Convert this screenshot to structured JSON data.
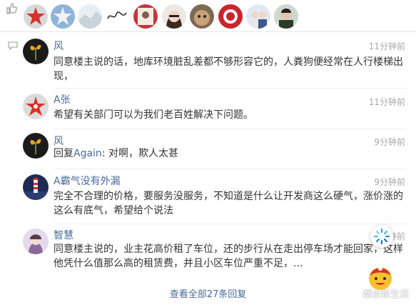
{
  "comments": [
    {
      "name": "风",
      "time": "11分钟前",
      "text": "同意楼主说的话，地库环境脏乱差都不够形容它的，人粪狗便经常在人行楼梯出现，"
    },
    {
      "name": "A张",
      "time": "11分钟前",
      "text": "希望有关部门可以为我们老百姓解决下问题。"
    },
    {
      "name": "风",
      "time": "9分钟前",
      "reply_prefix": "回复",
      "reply_target": "Again",
      "text": ": 对啊，欺人太甚"
    },
    {
      "name": "A霸气没有外漏",
      "time": "9分钟前",
      "text": "完全不合理的价格，要服务没服务，不知道是什么让开发商这么硬气，涨价涨的这么有底气，希望给个说法"
    },
    {
      "name": "智慧",
      "time": "9分钟前",
      "text": "同意楼主说的，业主花高价租了车位，还的步行从在走出停车场才能回家，这样他凭什么值那么高的租赁费，并且小区车位严重不足，..."
    }
  ],
  "view_all": "查看全部27条回复",
  "watermark": "烟台新生活",
  "likes_avatars": [
    "avatar-red-star",
    "avatar-blue-star",
    "avatar-snowy",
    "avatar-signature",
    "avatar-portrait-girl",
    "avatar-girl-glasses",
    "avatar-dog",
    "avatar-red-logo",
    "avatar-couple",
    "avatar-man"
  ]
}
